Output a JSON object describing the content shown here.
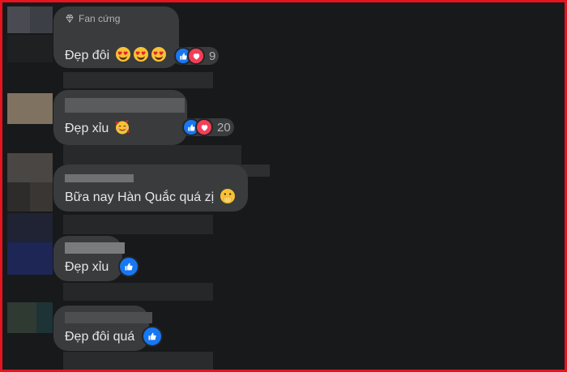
{
  "comments": [
    {
      "badge": "Fan cứng",
      "text": "Đẹp đôi",
      "reactions": {
        "like": true,
        "love": true,
        "count": "9"
      }
    },
    {
      "text": "Đẹp xỉu",
      "reactions": {
        "like": true,
        "love": true,
        "count": "20"
      }
    },
    {
      "text": "Bữa nay Hàn Quắc quá zị"
    },
    {
      "text": "Đẹp xỉu",
      "reactions": {
        "like": true
      }
    },
    {
      "text": "Đẹp đôi quá",
      "reactions": {
        "like": true
      }
    }
  ],
  "icons": {
    "badge": "diamond-icon",
    "like": "thumbs-up-icon",
    "love": "heart-icon",
    "emoji_heart_eyes": "heart-eyes-emoji-icon",
    "emoji_smiling_hearts": "smiling-hearts-emoji-icon",
    "emoji_hand_over_mouth": "hand-over-mouth-emoji-icon"
  },
  "colors": {
    "frame_border": "#e5141e",
    "background": "#18191a",
    "bubble": "#3a3b3c",
    "like": "#1877f2",
    "love": "#f33e58"
  }
}
